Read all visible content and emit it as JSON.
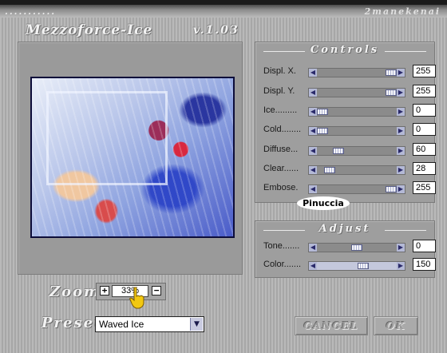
{
  "window": {
    "top_left_text": "...........",
    "brand": "2manekenai",
    "title": "Mezzoforce-Ice",
    "version": "v.1.03"
  },
  "controls": {
    "title": "Controls",
    "sliders": [
      {
        "label": "Displ. X.",
        "value": "255",
        "level": 1.0
      },
      {
        "label": "Displ. Y.",
        "value": "255",
        "level": 1.0
      },
      {
        "label": "Ice.........",
        "value": "0",
        "level": 0.0
      },
      {
        "label": "Cold........",
        "value": "0",
        "level": 0.0
      },
      {
        "label": "Diffuse...",
        "value": "60",
        "level": 0.235
      },
      {
        "label": "Clear......",
        "value": "28",
        "level": 0.11
      },
      {
        "label": "Embose.",
        "value": "255",
        "level": 1.0
      }
    ]
  },
  "signature": "Pinuccia",
  "adjust": {
    "title": "Adjust",
    "sliders": [
      {
        "label": "Tone.......",
        "value": "0",
        "level": 0.5
      },
      {
        "label": "Color.......",
        "value": "150",
        "level": 0.59
      }
    ]
  },
  "zoom": {
    "label": "Zoom",
    "plus": "+",
    "minus": "−",
    "value": "33%"
  },
  "preset": {
    "label": "Preset",
    "value": "Waved Ice"
  },
  "buttons": {
    "cancel": "CANCEL",
    "ok": "OK"
  },
  "icons": {
    "scroll_left": "arrow-left-icon",
    "scroll_right": "arrow-right-icon",
    "dropdown": "chevron-down-icon",
    "pointer": "hand-pointer-icon"
  }
}
